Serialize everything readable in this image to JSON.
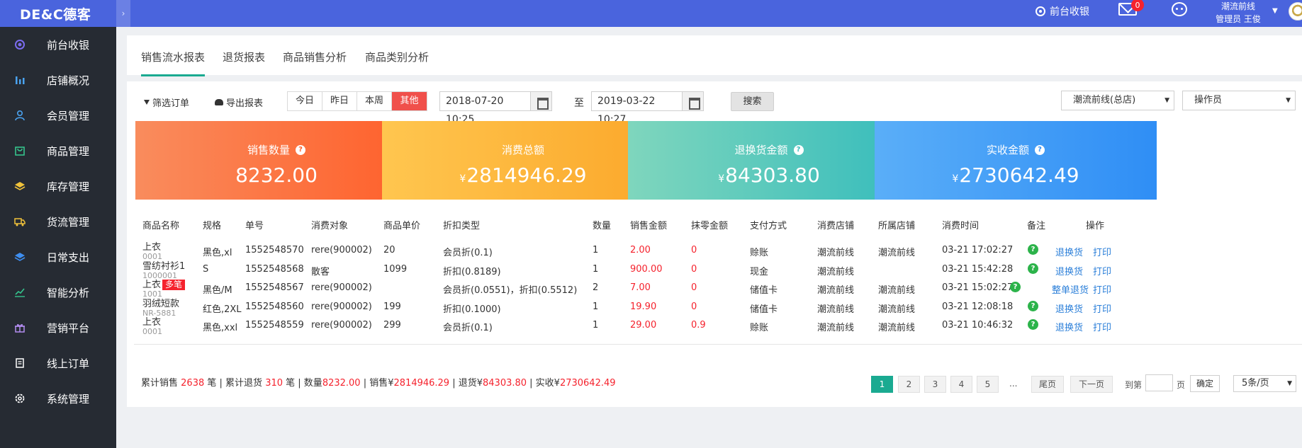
{
  "header": {
    "logo": "DE&C德客",
    "collapse_glyph": "›",
    "cashier_label": "前台收银",
    "mail_count": "0",
    "store_name": "潮流前线",
    "user_role": "管理员 王俊"
  },
  "sidebar": {
    "items": [
      {
        "label": "前台收银",
        "icon": "cashier-icon"
      },
      {
        "label": "店铺概况",
        "icon": "bar-chart-icon"
      },
      {
        "label": "会员管理",
        "icon": "member-icon"
      },
      {
        "label": "商品管理",
        "icon": "bag-icon"
      },
      {
        "label": "库存管理",
        "icon": "layers-icon"
      },
      {
        "label": "货流管理",
        "icon": "truck-icon"
      },
      {
        "label": "日常支出",
        "icon": "stack-icon"
      },
      {
        "label": "智能分析",
        "icon": "trend-icon"
      },
      {
        "label": "营销平台",
        "icon": "gift-icon"
      },
      {
        "label": "线上订单",
        "icon": "order-icon"
      },
      {
        "label": "系统管理",
        "icon": "gear-icon"
      }
    ]
  },
  "tabs": [
    "销售流水报表",
    "退货报表",
    "商品销售分析",
    "商品类别分析"
  ],
  "filters": {
    "filter_orders": "筛选订单",
    "export_report": "导出报表",
    "ranges": [
      "今日",
      "昨日",
      "本周",
      "其他"
    ],
    "start_date": "2018-07-20 10:25",
    "to_label": "至",
    "end_date": "2019-03-22 10:27",
    "search": "搜索",
    "store_select": "潮流前线(总店)",
    "operator_select": "操作员"
  },
  "stats": [
    {
      "title": "销售数量",
      "value": "8232.00",
      "currency": "",
      "help": true,
      "color_from": "#f98c5d",
      "color_to": "#ff5f2a"
    },
    {
      "title": "消费总额",
      "value": "2814946.29",
      "currency": "¥",
      "help": false,
      "color_from": "#ffc64f",
      "color_to": "#fba72a"
    },
    {
      "title": "退换货金额",
      "value": "84303.80",
      "currency": "¥",
      "help": true,
      "color_from": "#7fd6bd",
      "color_to": "#36bcbc"
    },
    {
      "title": "实收金额",
      "value": "2730642.49",
      "currency": "¥",
      "help": true,
      "color_from": "#5aaef8",
      "color_to": "#2f8ef5"
    }
  ],
  "table": {
    "headers": [
      "商品名称",
      "规格",
      "单号",
      "消费对象",
      "商品单价",
      "折扣类型",
      "数量",
      "销售金额",
      "抹零金额",
      "支付方式",
      "消费店铺",
      "所属店铺",
      "消费时间",
      "备注",
      "操作"
    ],
    "rows": [
      {
        "name": "上衣",
        "code": "0001",
        "tag": "",
        "spec": "黑色,xl",
        "order": "1552548570",
        "customer": "rere(900002)",
        "price": "20",
        "discount": "会员折(0.1)",
        "qty": "1",
        "amount": "2.00",
        "rounding": "0",
        "pay": "赊账",
        "shop": "潮流前线",
        "home_shop": "潮流前线",
        "time": "03-21 17:02:27",
        "action": "退换货",
        "print": "打印"
      },
      {
        "name": "雪纺衬衫1",
        "code": "1000001",
        "tag": "",
        "spec": "S",
        "order": "1552548568",
        "customer": "散客",
        "price": "1099",
        "discount": "折扣(0.8189)",
        "qty": "1",
        "amount": "900.00",
        "rounding": "0",
        "pay": "现金",
        "shop": "潮流前线",
        "home_shop": "",
        "time": "03-21 15:42:28",
        "action": "退换货",
        "print": "打印"
      },
      {
        "name": "上衣",
        "code": "1001",
        "tag": "多笔",
        "spec": "黑色/M",
        "order": "1552548567",
        "customer": "rere(900002)",
        "price": "",
        "discount": "会员折(0.0551)，折扣(0.5512)",
        "qty": "2",
        "amount": "7.00",
        "rounding": "0",
        "pay": "储值卡",
        "shop": "潮流前线",
        "home_shop": "潮流前线",
        "time": "03-21 15:02:27",
        "action": "整单退货",
        "print": "打印"
      },
      {
        "name": "羽绒短款",
        "code": "NR-5881",
        "tag": "",
        "spec": "红色,2XL",
        "order": "1552548560",
        "customer": "rere(900002)",
        "price": "199",
        "discount": "折扣(0.1000)",
        "qty": "1",
        "amount": "19.90",
        "rounding": "0",
        "pay": "储值卡",
        "shop": "潮流前线",
        "home_shop": "潮流前线",
        "time": "03-21 12:08:18",
        "action": "退换货",
        "print": "打印"
      },
      {
        "name": "上衣",
        "code": "0001",
        "tag": "",
        "spec": "黑色,xxl",
        "order": "1552548559",
        "customer": "rere(900002)",
        "price": "299",
        "discount": "会员折(0.1)",
        "qty": "1",
        "amount": "29.00",
        "rounding": "0.9",
        "pay": "赊账",
        "shop": "潮流前线",
        "home_shop": "潮流前线",
        "time": "03-21 10:46:32",
        "action": "退换货",
        "print": "打印"
      }
    ]
  },
  "summary": {
    "p1": "累计销售",
    "sales_count": "2638",
    "p2": "笔 | 累计退货",
    "return_count": "310",
    "p3": "笔 | 数量",
    "qty": "8232.00",
    "p4": " | 销售¥",
    "sales": "2814946.29",
    "p5": " | 退货¥",
    "returns": "84303.80",
    "p6": " | 实收¥",
    "received": "2730642.49"
  },
  "pagination": {
    "pages": [
      "1",
      "2",
      "3",
      "4",
      "5"
    ],
    "ellipsis": "...",
    "last": "尾页",
    "next": "下一页",
    "goto": "到第",
    "page_unit": "页",
    "confirm": "确定",
    "per_page": "5条/页"
  }
}
